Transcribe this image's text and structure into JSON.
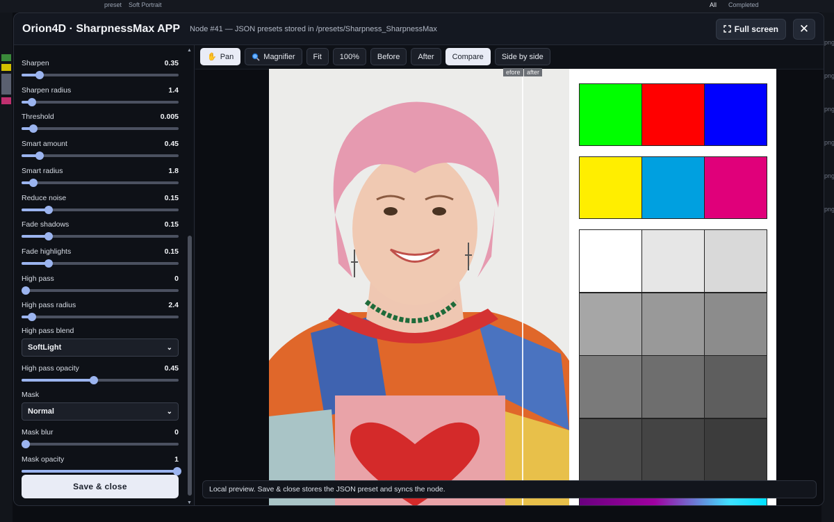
{
  "background": {
    "tabs": [
      "preset",
      "Soft Portrait",
      "All",
      "Completed"
    ],
    "right_labels": [
      "png",
      "png",
      "png",
      "png",
      "png",
      "png"
    ]
  },
  "header": {
    "title": "Orion4D · SharpnessMax APP",
    "subtitle": "Node #41 — JSON presets stored in /presets/Sharpness_SharpnessMax",
    "fullscreen_label": "Full screen",
    "close_label": "✕"
  },
  "params": [
    {
      "label": "Sharpen",
      "value": "0.35",
      "fraction": 0.09
    },
    {
      "label": "Sharpen radius",
      "value": "1.4",
      "fraction": 0.04
    },
    {
      "label": "Threshold",
      "value": "0.005",
      "fraction": 0.05
    },
    {
      "label": "Smart amount",
      "value": "0.45",
      "fraction": 0.09
    },
    {
      "label": "Smart radius",
      "value": "1.8",
      "fraction": 0.05
    },
    {
      "label": "Reduce noise",
      "value": "0.15",
      "fraction": 0.15
    },
    {
      "label": "Fade shadows",
      "value": "0.15",
      "fraction": 0.15
    },
    {
      "label": "Fade highlights",
      "value": "0.15",
      "fraction": 0.15
    },
    {
      "label": "High pass",
      "value": "0",
      "fraction": 0.0
    },
    {
      "label": "High pass radius",
      "value": "2.4",
      "fraction": 0.04
    }
  ],
  "blend": {
    "label": "High pass blend",
    "value": "SoftLight"
  },
  "opacity": {
    "label": "High pass opacity",
    "value": "0.45",
    "fraction": 0.45
  },
  "mask": {
    "label": "Mask",
    "value": "Normal"
  },
  "mask_blur": {
    "label": "Mask blur",
    "value": "0",
    "fraction": 0.0
  },
  "mask_opacity": {
    "label": "Mask opacity",
    "value": "1",
    "fraction": 1.0
  },
  "save_label": "Save & close",
  "toolbar": {
    "pan": "Pan",
    "magnifier": "Magnifier",
    "fit": "Fit",
    "zoom": "100%",
    "before": "Before",
    "after": "After",
    "compare": "Compare",
    "side_by_side": "Side by side"
  },
  "compare_tags": {
    "before": "efore",
    "after": "after"
  },
  "status_text": "Local preview. Save & close stores the JSON preset and syncs the node.",
  "colors": {
    "accent": "#9bb4ef",
    "chart_row1": [
      "#00ff00",
      "#ff0000",
      "#0000ff"
    ],
    "chart_row2": [
      "#ffee00",
      "#00a0e0",
      "#e0007a"
    ],
    "chart_grays": [
      "#ffffff",
      "#e6e6e6",
      "#d9d9d9",
      "#a6a6a6",
      "#999999",
      "#8c8c8c",
      "#7a7a7a",
      "#6e6e6e",
      "#5e5e5e",
      "#4a4a4a",
      "#444444",
      "#3c3c3c"
    ]
  }
}
